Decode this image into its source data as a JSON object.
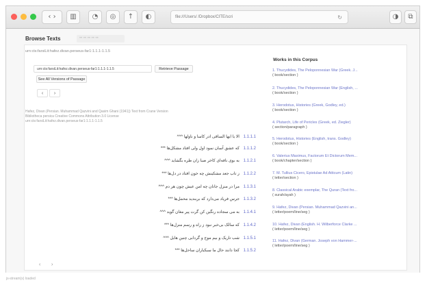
{
  "browser": {
    "address": "file:///Users/                   /Dropbox/CITE/scri",
    "reload_icon": "reload-icon",
    "colors": {
      "close": "#fc605b",
      "minimize": "#fdbc40",
      "maximize": "#34c84a"
    }
  },
  "page": {
    "title": "Browse Texts",
    "title_tab": "•• •• •• •• ••",
    "urn_header": "urn:cts:farsiLit:hafez.divan.perseus-far1:1.1.1-1.1.5",
    "urn_value": "urn:cts:farsiLit:hafez.divan.perseus-far1:1.1.1-1.1.5",
    "retrieve_label": "Retrieve Passage",
    "see_all_label": "See All Versions of Passage",
    "prev_label": "‹",
    "next_label": "›",
    "meta_lines": [
      "Hafez, Divan (Persian. Muhammad Qazvini and Qasim Ghani (1941)) Text from Crane Version",
      "Bibliotheca persica Creative Commons Attribution 3.0 License",
      "urn:cts:farsiLit:hafez.divan.perseus-far1:1.1.1-1.1.5"
    ],
    "bottom_prev": "‹",
    "bottom_next": "›",
    "status": "js-stream(s) loaded"
  },
  "verses": [
    {
      "ref": "1.1.1.1",
      "text": "الا یا ایها الساقی ادر کاسا و ناولها ^^^"
    },
    {
      "ref": "1.1.1.2",
      "text": "که عشق آسان نمود اول ولی افتاد مشکل‌ها ***"
    },
    {
      "ref": "1.1.2.1",
      "text": "به بوی نافه‌ای کاخر صبا زان طره بگشاید ^^^"
    },
    {
      "ref": "1.1.2.2",
      "text": "ز تاب جعد مشکینش چه خون افتاد در دل‌ها ***"
    },
    {
      "ref": "1.1.3.1",
      "text": "مرا در منزل جانان چه امن عیش چون هر دم ^^^"
    },
    {
      "ref": "1.1.3.2",
      "text": "جرس فریاد می‌دارد که بربندید محمل‌ها ***"
    },
    {
      "ref": "1.1.4.1",
      "text": "به می سجاده رنگین کن گرت پیر مغان گوید ^^^"
    },
    {
      "ref": "1.1.4.2",
      "text": "که سالک بی‌خبر نبود ز راه و رسم منزل‌ها ***"
    },
    {
      "ref": "1.1.5.1",
      "text": "شب تاریک و بیم موج و گردابی چنین هایل ^^^"
    },
    {
      "ref": "1.1.5.2",
      "text": "کجا دانند حال ما سبکباران ساحل‌ها ***"
    }
  ],
  "sidebar": {
    "title": "Works in this Corpus",
    "works": [
      {
        "title": "1. Thucydides, The Peloponnesian War (Greek. J...",
        "scheme": "( book/section )"
      },
      {
        "title": "2. Thucydides, The Peloponnesian War (English, ...",
        "scheme": "( book/section )"
      },
      {
        "title": "3. Herodotus, Histories (Greek, Godley, ed.)",
        "scheme": "( book/section )"
      },
      {
        "title": "4. Plutarch, Life of Pericles (Greek, ed. Ziegler)",
        "scheme": "( section/paragraph )"
      },
      {
        "title": "5. Herodotus, Histories (English, trans. Godley)",
        "scheme": "( book/section )"
      },
      {
        "title": "6. Valerius Maximus, Factorum Et Dictorum Mem...",
        "scheme": "( book/chapter/section )"
      },
      {
        "title": "7. M. Tullius Cicero, Epistulae Ad Atticum (Latin)",
        "scheme": "( letter/section )"
      },
      {
        "title": "8. Classical Arabic exemplar, The Quran (Text fro...",
        "scheme": "( surah/ayah )"
      },
      {
        "title": "9. Hafez, Divan (Persian. Muhammad Qazvini an...",
        "scheme": "( letter/poem/line/seg )"
      },
      {
        "title": "10. Hafez, Divan (English. H. Wilberforce Clarke ...",
        "scheme": "( letter/poem/line/seg )"
      },
      {
        "title": "11. Hafez, Divan (German. Joseph von Hammer-...",
        "scheme": "( letter/poem/line/seg )"
      }
    ]
  }
}
